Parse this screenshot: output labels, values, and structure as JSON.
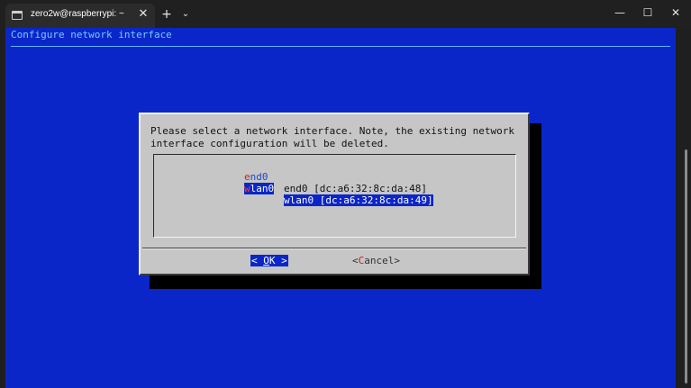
{
  "window": {
    "tab_title": "zero2w@raspberrypi: ~",
    "tab_close": "✕",
    "new_tab": "+",
    "tab_dropdown": "⌄",
    "minimize": "—",
    "maximize": "☐",
    "close": "✕"
  },
  "terminal": {
    "heading": "Configure network interface",
    "dialog": {
      "prompt": "Please select a network interface. Note, the existing network\ninterface configuration will be deleted.",
      "items": [
        {
          "tag_hotkey": "e",
          "tag_rest": "nd0",
          "desc": "end0 [dc:a6:32:8c:da:48]",
          "selected": false
        },
        {
          "tag_hotkey": "w",
          "tag_rest": "lan0",
          "desc": "wlan0 [dc:a6:32:8c:da:49]",
          "selected": true
        }
      ],
      "ok_button": {
        "left": "< ",
        "hotkey": "O",
        "rest": "K",
        "right": " >"
      },
      "cancel_button": {
        "left": "<",
        "hotkey": "C",
        "rest": "ancel",
        "right": ">"
      }
    }
  },
  "colors": {
    "terminal_bg": "#0b26c8",
    "dialog_bg": "#c6c6c6",
    "hotkey": "#d71b1b",
    "heading": "#79c7ff"
  }
}
